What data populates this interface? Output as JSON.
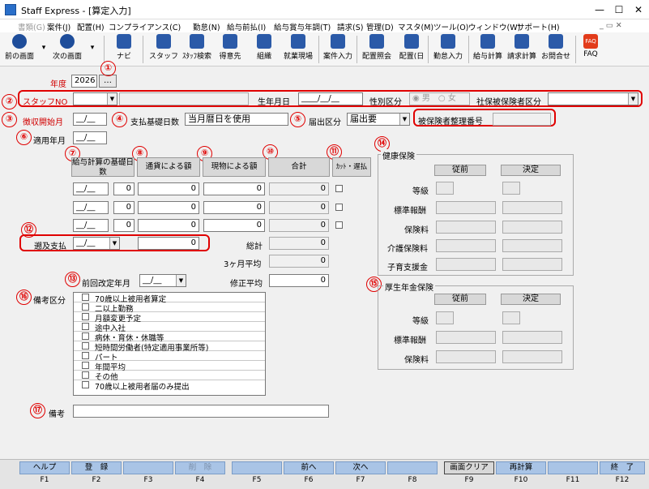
{
  "window": {
    "title": "Staff Express - [算定入力]",
    "minimize": "—",
    "maximize": "☐",
    "close": "✕"
  },
  "menu": [
    "書類(G)",
    "案件(J)",
    "配置(H)",
    "コンプライアンス(C)",
    "勤怠(N)",
    "給与前払(I)",
    "給与賞与年調(T)",
    "請求(S)",
    "管理(D)",
    "マスタ(M)",
    "ツール(O)",
    "ウィンドウ(W)",
    "サポート(H)"
  ],
  "toolbar": {
    "prev": "前の画面",
    "next": "次の画面",
    "navi": "ナビ",
    "staff": "スタッフ",
    "staff_search": "ｽﾀｯﾌ検索",
    "client": "得意先",
    "org": "組織",
    "workplace": "就業現場",
    "case_input": "案件入力",
    "assign_inquiry": "配置照会",
    "assign_day": "配置(日",
    "attendance": "勤怠入力",
    "pay_calc": "給与計算",
    "bill_calc": "請求計算",
    "contact": "お問合せ",
    "faq": "FAQ",
    "faq_icon": "FAQ"
  },
  "form": {
    "year_label": "年度",
    "year_value": "2026",
    "year_btn": "…",
    "staff_no_label": "スタッフNO",
    "birth_label": "生年月日",
    "gender_label": "性別区分",
    "male": "男",
    "female": "女",
    "insured_type_label": "社保被保険者区分",
    "collect_start_label": "徴収開始月",
    "pay_basis_label": "支払基礎日数",
    "pay_basis_value": "当月暦日を使用",
    "report_label": "届出区分",
    "report_value": "届出要",
    "insured_no_label": "被保険者整理番号",
    "apply_ym_label": "適用年月",
    "col_basis": "給与計算の基礎日数",
    "col_currency": "通貨による額",
    "col_goods": "現物による額",
    "col_total": "合計",
    "col_cut": "ｶｯﾄ・遅払",
    "rows": [
      {
        "days": "0",
        "cur": "0",
        "goods": "0",
        "total": "0"
      },
      {
        "days": "0",
        "cur": "0",
        "goods": "0",
        "total": "0"
      },
      {
        "days": "0",
        "cur": "0",
        "goods": "0",
        "total": "0"
      }
    ],
    "retro_label": "遡及支払",
    "retro_value": "0",
    "grand_total_label": "総計",
    "grand_total": "0",
    "avg3_label": "3ヶ月平均",
    "avg3": "0",
    "prev_revise_label": "前回改定年月",
    "fix_avg_label": "修正平均",
    "fix_avg": "0",
    "remarks_kind_label": "備考区分",
    "remarks_list": [
      "70歳以上被用者算定",
      "二以上勤務",
      "月額変更予定",
      "途中入社",
      "病休・育休・休職等",
      "短時間労働者(特定適用事業所等)",
      "パート",
      "年間平均",
      "その他",
      "70歳以上被用者届のみ提出"
    ],
    "remarks_label": "備考",
    "date_placeholder": "__/__",
    "date_full": "____/__/__"
  },
  "health": {
    "title": "健康保険",
    "before": "従前",
    "decided": "決定",
    "grade": "等級",
    "std_pay": "標準報酬",
    "premium": "保険料",
    "care_premium": "介護保険料",
    "child_support": "子育支援金"
  },
  "pension": {
    "title": "厚生年金保険",
    "before": "従前",
    "decided": "決定",
    "grade": "等級",
    "std_pay": "標準報酬",
    "premium": "保険料"
  },
  "fkeys": [
    {
      "label": "ヘルプ",
      "num": "F1"
    },
    {
      "label": "登　録",
      "num": "F2"
    },
    {
      "label": "",
      "num": "F3"
    },
    {
      "label": "削　除",
      "num": "F4"
    },
    {
      "label": "",
      "num": "F5"
    },
    {
      "label": "前へ",
      "num": "F6"
    },
    {
      "label": "次へ",
      "num": "F7"
    },
    {
      "label": "",
      "num": "F8"
    },
    {
      "label": "画面クリア",
      "num": "F9"
    },
    {
      "label": "再計算",
      "num": "F10"
    },
    {
      "label": "",
      "num": "F11"
    },
    {
      "label": "終　了",
      "num": "F12"
    }
  ],
  "markers": [
    "①",
    "②",
    "③",
    "④",
    "⑤",
    "⑥",
    "⑦",
    "⑧",
    "⑨",
    "⑩",
    "⑪",
    "⑫",
    "⑬",
    "⑭",
    "⑮",
    "⑯",
    "⑰"
  ]
}
